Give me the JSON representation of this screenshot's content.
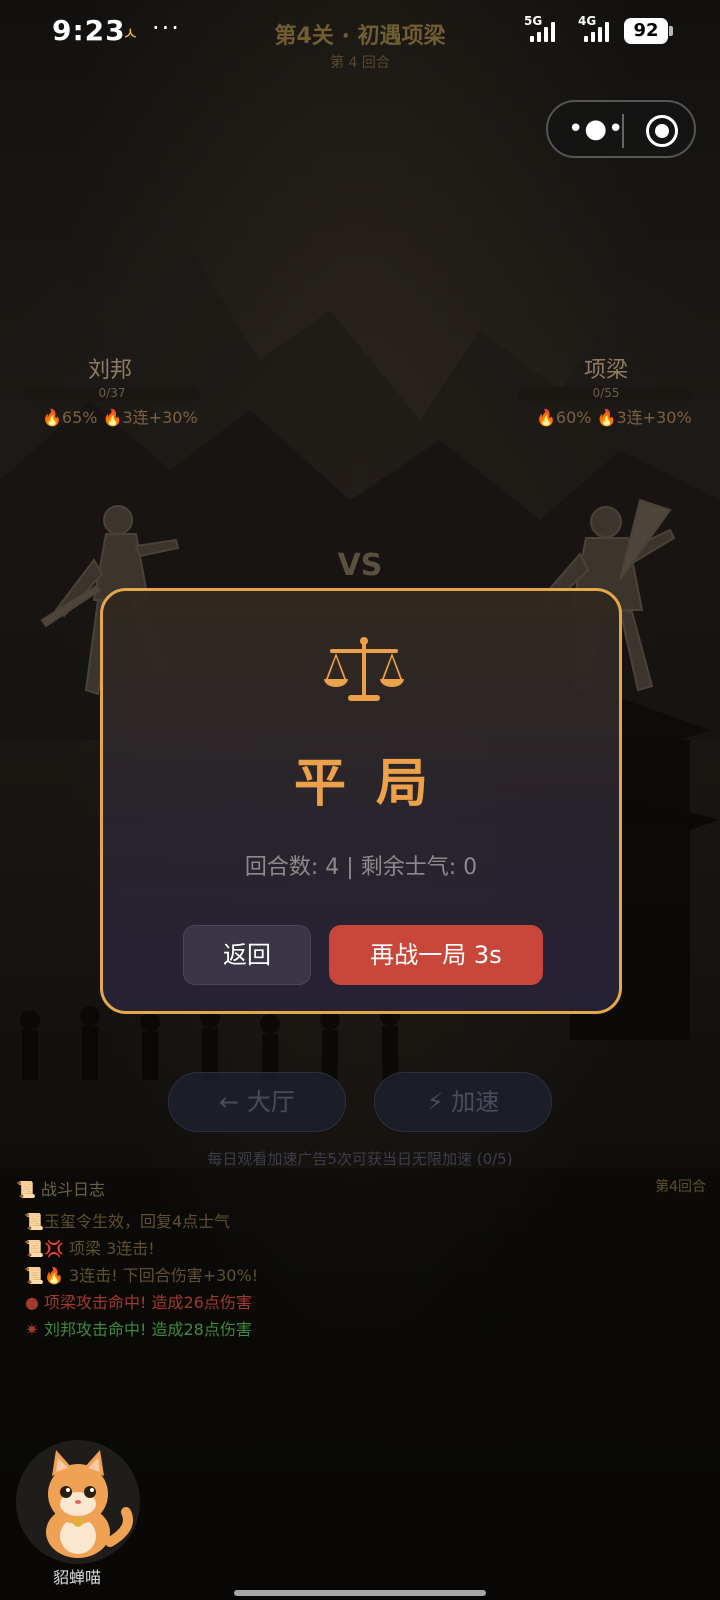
{
  "status": {
    "time": "9:23",
    "net1": "5G",
    "net2": "4G",
    "battery": "92"
  },
  "header": {
    "level_title": "第4关 · 初遇项梁",
    "round_sub": "第 4 回合"
  },
  "left_fighter": {
    "name": "刘邦",
    "hp": "0/37",
    "buffs": "🔥65% 🔥3连+30%"
  },
  "right_fighter": {
    "name": "项梁",
    "hp": "0/55",
    "buffs": "🔥60% 🔥3连+30%"
  },
  "vs": "VS",
  "dialog": {
    "result": "平局",
    "stats": "回合数: 4 | 剩余士气: 0",
    "back_label": "返回",
    "retry_label": "再战一局 3s"
  },
  "actions": {
    "lobby_label": "← 大厅",
    "speed_label": "⚡ 加速",
    "ad_note": "每日观看加速广告5次可获当日无限加速 (0/5)"
  },
  "log": {
    "title": "战斗日志",
    "round": "第4回合",
    "lines": [
      {
        "icon": "scroll-icon",
        "text": "玉玺令生效，回复4点士气",
        "color": "#5e5030"
      },
      {
        "icon": "scroll-icon",
        "text": "💢 项梁 3连击!",
        "color": "#5e5030"
      },
      {
        "icon": "scroll-icon",
        "text": "🔥 3连击! 下回合伤害+30%!",
        "color": "#5e5030"
      },
      {
        "icon": "blood-icon",
        "text": "项梁攻击命中! 造成26点伤害",
        "color": "#a03a2c"
      },
      {
        "icon": "impact-icon",
        "text": "刘邦攻击命中! 造成28点伤害",
        "color": "#3f8a3a"
      }
    ]
  },
  "mascot": {
    "name": "貂蝉喵"
  },
  "colors": {
    "accent": "#e6a64a",
    "retry": "#c8473a"
  }
}
